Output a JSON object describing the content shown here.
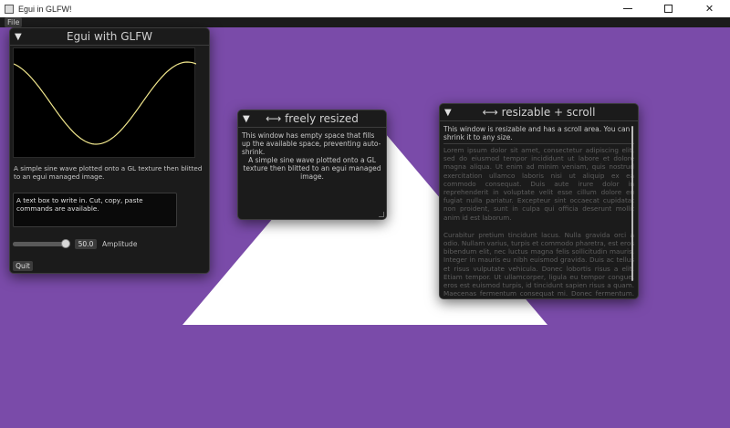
{
  "window": {
    "title": "Egui in GLFW!",
    "controls": [
      "—",
      "□",
      "✕"
    ]
  },
  "menu": {
    "file": "File"
  },
  "colors": {
    "background": "#7a4ba9",
    "panel": "#1b1b1b",
    "triangle": "#ffffff",
    "sine": "#f0e68c"
  },
  "main_window": {
    "title": "Egui with GLFW",
    "collapse_icon": "▼",
    "description": "A simple sine wave plotted onto a GL texture then blitted to an egui managed image.",
    "textbox": "A text box to write in. Cut, copy, paste commands are available.",
    "amplitude_value": "50.0",
    "amplitude_label": "Amplitude",
    "quit_label": "Quit"
  },
  "free_window": {
    "title": "⟷ freely resized",
    "collapse_icon": "▼",
    "line1": "This window has empty space that fills up the available space, preventing auto-shrink.",
    "line2": "A simple sine wave plotted onto a GL texture then blitted to an egui managed image."
  },
  "scroll_window": {
    "title": "⟷ resizable + scroll",
    "collapse_icon": "▼",
    "intro": "This window is resizable and has a scroll area. You can shrink it to any size.",
    "lorem1": "Lorem ipsum dolor sit amet, consectetur adipiscing elit, sed do eiusmod tempor incididunt ut labore et dolore magna aliqua. Ut enim ad minim veniam, quis nostrud exercitation ullamco laboris nisi ut aliquip ex ea commodo consequat. Duis aute irure dolor in reprehenderit in voluptate velit esse cillum dolore eu fugiat nulla pariatur. Excepteur sint occaecat cupidatat non proident, sunt in culpa qui officia deserunt mollit anim id est laborum.",
    "lorem2": "Curabitur pretium tincidunt lacus. Nulla gravida orci a odio. Nullam varius, turpis et commodo pharetra, est eros bibendum elit, nec luctus magna felis sollicitudin mauris. Integer in mauris eu nibh euismod gravida. Duis ac tellus et risus vulputate vehicula. Donec lobortis risus a elit. Etiam tempor. Ut ullamcorper, ligula eu tempor congue, eros est euismod turpis, id tincidunt sapien risus a quam. Maecenas fermentum consequat mi. Donec fermentum. Pellentesque malesuada nulla a mi. Duis sapien sem, aliquet nec, commodo eget, consequat quis, neque."
  }
}
